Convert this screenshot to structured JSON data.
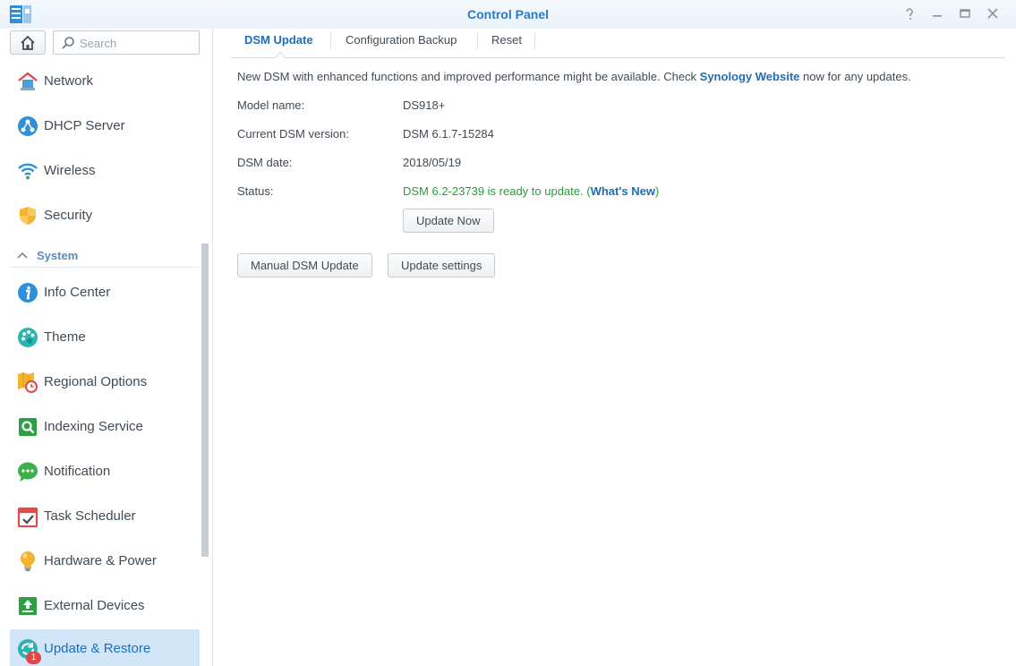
{
  "window": {
    "title": "Control Panel",
    "controls": {
      "help": "?",
      "minimize": "—",
      "maximize": "□",
      "close": "✕"
    }
  },
  "search": {
    "placeholder": "Search"
  },
  "sidebar": {
    "items_top": [
      {
        "label": "Network",
        "icon": "network-icon"
      },
      {
        "label": "DHCP Server",
        "icon": "dhcp-server-icon"
      },
      {
        "label": "Wireless",
        "icon": "wireless-icon"
      },
      {
        "label": "Security",
        "icon": "security-shield-icon"
      }
    ],
    "section": {
      "label": "System",
      "expanded": true
    },
    "items_system": [
      {
        "label": "Info Center",
        "icon": "info-icon"
      },
      {
        "label": "Theme",
        "icon": "theme-palette-icon"
      },
      {
        "label": "Regional Options",
        "icon": "regional-options-icon"
      },
      {
        "label": "Indexing Service",
        "icon": "indexing-service-icon"
      },
      {
        "label": "Notification",
        "icon": "notification-icon"
      },
      {
        "label": "Task Scheduler",
        "icon": "task-scheduler-icon"
      },
      {
        "label": "Hardware & Power",
        "icon": "hardware-power-bulb-icon"
      },
      {
        "label": "External Devices",
        "icon": "external-devices-icon"
      },
      {
        "label": "Update & Restore",
        "icon": "update-restore-icon",
        "active": true,
        "badge": "1"
      }
    ]
  },
  "tabs": [
    {
      "label": "DSM Update",
      "active": true
    },
    {
      "label": "Configuration Backup",
      "active": false
    },
    {
      "label": "Reset",
      "active": false
    }
  ],
  "main": {
    "notice": {
      "prefix": "New DSM with enhanced functions and improved performance might be available. Check ",
      "link": "Synology Website",
      "suffix": " now for any updates."
    },
    "rows": [
      {
        "label": "Model name:",
        "value": "DS918+"
      },
      {
        "label": "Current DSM version:",
        "value": "DSM 6.1.7-15284"
      },
      {
        "label": "DSM date:",
        "value": "2018/05/19"
      }
    ],
    "status": {
      "label": "Status:",
      "text": "DSM 6.2-23739 is ready to update. (",
      "link": "What's New",
      "close": ")"
    },
    "buttons": {
      "update_now": "Update Now",
      "manual_update": "Manual DSM Update",
      "update_settings": "Update settings"
    }
  },
  "colors": {
    "accent": "#1f6db4",
    "status_green": "#24a134",
    "active_item_bg": "#d2e6f9",
    "badge_red": "#e64545"
  }
}
